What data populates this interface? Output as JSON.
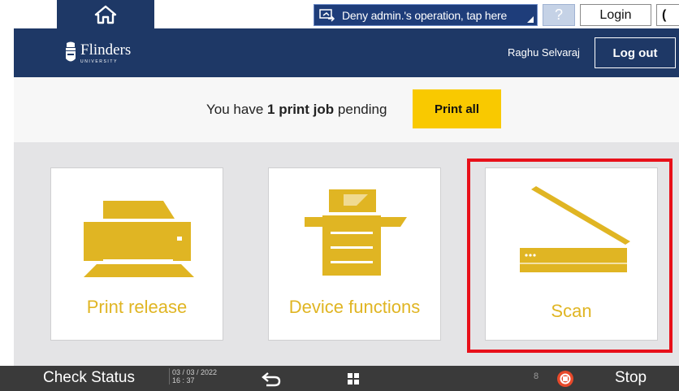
{
  "system_bar": {
    "home_icon": "home-icon",
    "admin_notice": "Deny admin.'s operation, tap here",
    "help_label": "?",
    "login_label": "Login",
    "power_label": "("
  },
  "header": {
    "logo_name": "Flinders",
    "logo_sub": "UNIVERSITY",
    "user_name": "Raghu Selvaraj",
    "logout_label": "Log out"
  },
  "pending": {
    "prefix": "You have ",
    "count": "1",
    "bold_text": " print job",
    "suffix": " pending",
    "print_all_label": "Print all"
  },
  "tiles": [
    {
      "label": "Print release",
      "icon": "printer-icon"
    },
    {
      "label": "Device functions",
      "icon": "copier-icon"
    },
    {
      "label": "Scan",
      "icon": "scanner-icon"
    }
  ],
  "bottom_bar": {
    "check_status_label": "Check Status",
    "date": "03 / 03 / 2022",
    "time": "16 : 37",
    "separator": "8",
    "stop_label": "Stop"
  },
  "colors": {
    "navy": "#1e3866",
    "accent_yellow": "#f9c900",
    "tile_gold": "#e0b523",
    "highlight_red": "#e8101a"
  }
}
